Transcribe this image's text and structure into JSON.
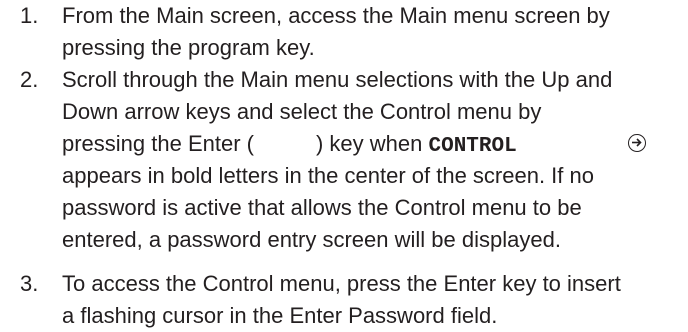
{
  "steps": [
    {
      "number": "1.",
      "lines": [
        "From the Main screen, access the Main menu screen by",
        "pressing the program key."
      ]
    },
    {
      "number": "2.",
      "lines": [
        "Scroll through the Main menu selections with the Up and",
        "Down arrow keys and select the Control menu by"
      ],
      "line3_before": "pressing  the Enter (",
      "line3_after": ") key when",
      "line3_code": "CONTROL",
      "lines_after": [
        "appears in bold letters in the center of the screen. If no",
        "password is active that allows the Control menu to be",
        "entered, a password entry screen will be displayed."
      ]
    },
    {
      "number": "3.",
      "lines": [
        "To access the Control menu, press the Enter key to insert",
        "a flashing cursor in the Enter Password field."
      ]
    }
  ],
  "icons": {
    "enter": "enter-key-icon"
  }
}
